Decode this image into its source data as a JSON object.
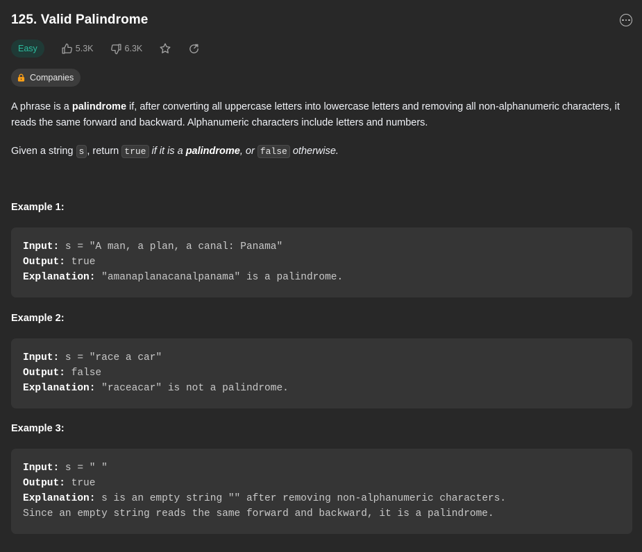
{
  "problem": {
    "title": "125. Valid Palindrome",
    "difficulty": "Easy",
    "likes": "5.3K",
    "dislikes": "6.3K",
    "companies_label": "Companies"
  },
  "description": {
    "p1_pre": "A phrase is a ",
    "p1_bold": "palindrome",
    "p1_post": " if, after converting all uppercase letters into lowercase letters and removing all non-alphanumeric characters, it reads the same forward and backward. Alphanumeric characters include letters and numbers.",
    "p2_a": "Given a string ",
    "p2_code_s": "s",
    "p2_b": ", return ",
    "p2_code_true": "true",
    "p2_c": " if it is a ",
    "p2_bold": "palindrome",
    "p2_d": ", or ",
    "p2_code_false": "false",
    "p2_e": " otherwise."
  },
  "examples": [
    {
      "title": "Example 1:",
      "input_label": "Input:",
      "input": " s = \"A man, a plan, a canal: Panama\"",
      "output_label": "Output:",
      "output": " true",
      "explanation_label": "Explanation:",
      "explanation": " \"amanaplanacanalpanama\" is a palindrome.",
      "explanation_cont": ""
    },
    {
      "title": "Example 2:",
      "input_label": "Input:",
      "input": " s = \"race a car\"",
      "output_label": "Output:",
      "output": " false",
      "explanation_label": "Explanation:",
      "explanation": " \"raceacar\" is not a palindrome.",
      "explanation_cont": ""
    },
    {
      "title": "Example 3:",
      "input_label": "Input:",
      "input": " s = \" \"",
      "output_label": "Output:",
      "output": " true",
      "explanation_label": "Explanation:",
      "explanation": " s is an empty string \"\" after removing non-alphanumeric characters.",
      "explanation_cont": "Since an empty string reads the same forward and backward, it is a palindrome."
    }
  ],
  "icons": {
    "more": "more-options-icon",
    "like": "thumbs-up-icon",
    "dislike": "thumbs-down-icon",
    "favorite": "star-icon",
    "share": "share-icon",
    "lock": "lock-icon"
  },
  "colors": {
    "background": "#282828",
    "easy": "#2cbb9d",
    "lock": "#ffa116"
  }
}
